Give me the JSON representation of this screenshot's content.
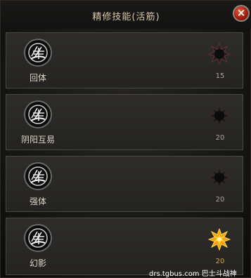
{
  "window": {
    "title": "精修技能(活筋)",
    "close_label": "×"
  },
  "skills": [
    {
      "name": "回体",
      "count": "15",
      "gem_state": "locked"
    },
    {
      "name": "阴阳互易",
      "count": "20",
      "gem_state": "locked"
    },
    {
      "name": "强体",
      "count": "20",
      "gem_state": "locked"
    },
    {
      "name": "幻影",
      "count": "20",
      "gem_state": "active"
    }
  ],
  "icons": {
    "skill_icon": "skill-rune-icon",
    "gem_locked": "dark-star-gem-icon",
    "gem_active": "gold-star-gem-icon"
  },
  "colors": {
    "title": "#d9c9a6",
    "gem_active": "#f5a20f",
    "gem_locked": "#1a1a1a",
    "close_button": "#a81e10"
  },
  "watermark": "drs.tgbus.com 巴士斗战神"
}
